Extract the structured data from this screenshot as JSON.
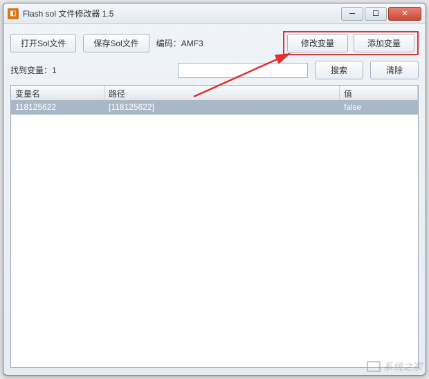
{
  "window": {
    "title": "Flash sol 文件修改器 1.5"
  },
  "toolbar": {
    "open_btn": "打开Sol文件",
    "save_btn": "保存Sol文件",
    "encoding_label": "编码：",
    "encoding_value": "AMF3",
    "modify_btn": "修改变量",
    "add_btn": "添加变量"
  },
  "search_row": {
    "found_label": "找到变量：",
    "found_count": "1",
    "search_input_value": "",
    "search_btn": "搜索",
    "clear_btn": "清除"
  },
  "table": {
    "headers": {
      "name": "变量名",
      "path": "路径",
      "value": "值"
    },
    "rows": [
      {
        "name": "118125622",
        "path": "[118125622]",
        "value": "false"
      }
    ]
  },
  "watermark": "系统之家"
}
